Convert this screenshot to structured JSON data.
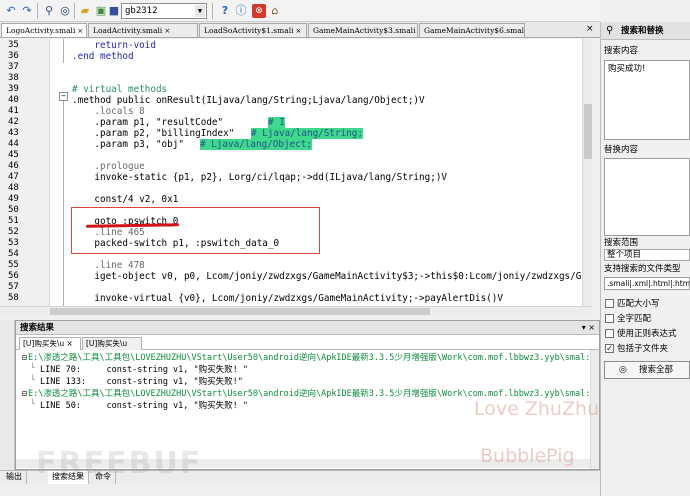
{
  "toolbar": {
    "search_value": "gb2312",
    "icons": [
      "undo-icon",
      "redo-icon",
      "find-icon",
      "binoculars-icon",
      "open-folder-icon",
      "image-icon",
      "save-icon",
      "help-icon",
      "info-icon",
      "stop-icon",
      "home-icon"
    ]
  },
  "tabs": [
    {
      "label": "LogoActivity.smali"
    },
    {
      "label": "LoadActivity.smali"
    },
    {
      "label": "LoadSoActivity$1.smali"
    },
    {
      "label": "GameMainActivity$3.smali"
    },
    {
      "label": "GameMainActivity$6.smali"
    }
  ],
  "editor": {
    "lines": [
      {
        "num": "35",
        "text": "    return-void"
      },
      {
        "num": "36",
        "text": ".end method"
      },
      {
        "num": "37",
        "text": ""
      },
      {
        "num": "38",
        "text": ""
      },
      {
        "num": "39",
        "text": "# virtual methods"
      },
      {
        "num": "40",
        "text": ".method public onResult(ILjava/lang/String;Ljava/lang/Object;)V"
      },
      {
        "num": "41",
        "text": "    .locals 8"
      },
      {
        "num": "42",
        "text": "    .param p1, \"resultCode\""
      },
      {
        "num": "43",
        "text": "    .param p2, \"billingIndex\""
      },
      {
        "num": "44",
        "text": "    .param p3, \"obj\""
      },
      {
        "num": "45",
        "text": ""
      },
      {
        "num": "46",
        "text": "    .prologue"
      },
      {
        "num": "47",
        "text": "    invoke-static {p1, p2}, Lorg/ci/lqap;->dd(ILjava/lang/String;)V"
      },
      {
        "num": "48",
        "text": ""
      },
      {
        "num": "49",
        "text": "    const/4 v2, 0x1"
      },
      {
        "num": "50",
        "text": ""
      },
      {
        "num": "51",
        "text": "    goto :pswitch_0"
      },
      {
        "num": "52",
        "text": "    .line 465"
      },
      {
        "num": "53",
        "text": "    packed-switch p1, :pswitch_data_0"
      },
      {
        "num": "54",
        "text": ""
      },
      {
        "num": "55",
        "text": "    .line 478"
      },
      {
        "num": "56",
        "text": "    iget-object v0, p0, Lcom/joniy/zwdzxgs/GameMainActivity$3;->this$0:Lcom/joniy/zwdzxgs/Gam"
      },
      {
        "num": "57",
        "text": ""
      },
      {
        "num": "58",
        "text": "    invoke-virtual {v0}, Lcom/joniy/zwdzxgs/GameMainActivity;->payAlertDis()V"
      }
    ],
    "comments": {
      "line42": "# I",
      "line43": "# Ljava/lang/String;",
      "line44": "# Ljava/lang/Object;"
    }
  },
  "results": {
    "title": "搜索结果",
    "tabs": [
      {
        "label": "[U]购买失\\u"
      },
      {
        "label": "[U]购买失\\u"
      }
    ],
    "entries": [
      {
        "kind": "path",
        "text": "E:\\渗透之路\\工具\\工具包\\LOVEZHUZHU\\VStart\\User50\\android逆向\\ApkIDE最新3.3.5少月增强版\\Work\\com.mof.lbbwz3.yyb\\smal:"
      },
      {
        "kind": "hit",
        "text": "LINE 70:     const-string v1, \"购买失败! \""
      },
      {
        "kind": "hit",
        "text": "LINE 133:    const-string v1, \"购买失败!\""
      },
      {
        "kind": "path",
        "text": "E:\\渗透之路\\工具\\工具包\\LOVEZHUZHU\\VStart\\User50\\android逆向\\ApkIDE最新3.3.5少月增强版\\Work\\com.mof.lbbwz3.yyb\\smal:"
      },
      {
        "kind": "hit",
        "text": "LINE 50:     const-string v1, \"购买失败! \""
      }
    ]
  },
  "bottom_tabs": [
    {
      "label": "输出"
    },
    {
      "label": "搜索结果"
    },
    {
      "label": "命令"
    }
  ],
  "search_panel": {
    "title": "搜索和替换",
    "search_label": "搜索内容",
    "search_value": "购买成功!",
    "replace_label": "替换内容",
    "replace_value": "",
    "scope_label": "搜索范围",
    "scope_value": "整个项目",
    "filetypes_label": "支持搜索的文件类型",
    "filetypes_value": ".smali|.xml|.html|.htm",
    "options": [
      {
        "label": "匹配大小写",
        "checked": false
      },
      {
        "label": "全字匹配",
        "checked": false
      },
      {
        "label": "使用正则表达式",
        "checked": false
      },
      {
        "label": "包括子文件夹",
        "checked": true
      }
    ],
    "search_all_label": "搜索全部"
  },
  "watermarks": {
    "love": "Love  ZhuZhu",
    "bubble": "BubblePig",
    "freebuf": "FREEBUF"
  }
}
